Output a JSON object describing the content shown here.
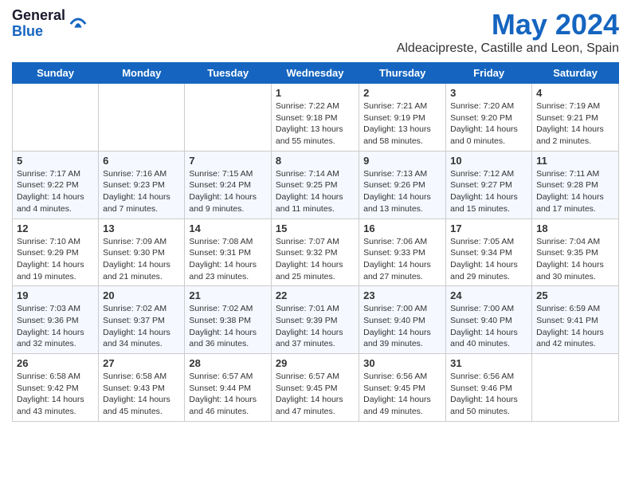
{
  "header": {
    "logo_general": "General",
    "logo_blue": "Blue",
    "month_title": "May 2024",
    "location": "Aldeacipreste, Castille and Leon, Spain"
  },
  "days_of_week": [
    "Sunday",
    "Monday",
    "Tuesday",
    "Wednesday",
    "Thursday",
    "Friday",
    "Saturday"
  ],
  "weeks": [
    [
      {
        "day": "",
        "sunrise": "",
        "sunset": "",
        "daylight": ""
      },
      {
        "day": "",
        "sunrise": "",
        "sunset": "",
        "daylight": ""
      },
      {
        "day": "",
        "sunrise": "",
        "sunset": "",
        "daylight": ""
      },
      {
        "day": "1",
        "sunrise": "Sunrise: 7:22 AM",
        "sunset": "Sunset: 9:18 PM",
        "daylight": "Daylight: 13 hours and 55 minutes."
      },
      {
        "day": "2",
        "sunrise": "Sunrise: 7:21 AM",
        "sunset": "Sunset: 9:19 PM",
        "daylight": "Daylight: 13 hours and 58 minutes."
      },
      {
        "day": "3",
        "sunrise": "Sunrise: 7:20 AM",
        "sunset": "Sunset: 9:20 PM",
        "daylight": "Daylight: 14 hours and 0 minutes."
      },
      {
        "day": "4",
        "sunrise": "Sunrise: 7:19 AM",
        "sunset": "Sunset: 9:21 PM",
        "daylight": "Daylight: 14 hours and 2 minutes."
      }
    ],
    [
      {
        "day": "5",
        "sunrise": "Sunrise: 7:17 AM",
        "sunset": "Sunset: 9:22 PM",
        "daylight": "Daylight: 14 hours and 4 minutes."
      },
      {
        "day": "6",
        "sunrise": "Sunrise: 7:16 AM",
        "sunset": "Sunset: 9:23 PM",
        "daylight": "Daylight: 14 hours and 7 minutes."
      },
      {
        "day": "7",
        "sunrise": "Sunrise: 7:15 AM",
        "sunset": "Sunset: 9:24 PM",
        "daylight": "Daylight: 14 hours and 9 minutes."
      },
      {
        "day": "8",
        "sunrise": "Sunrise: 7:14 AM",
        "sunset": "Sunset: 9:25 PM",
        "daylight": "Daylight: 14 hours and 11 minutes."
      },
      {
        "day": "9",
        "sunrise": "Sunrise: 7:13 AM",
        "sunset": "Sunset: 9:26 PM",
        "daylight": "Daylight: 14 hours and 13 minutes."
      },
      {
        "day": "10",
        "sunrise": "Sunrise: 7:12 AM",
        "sunset": "Sunset: 9:27 PM",
        "daylight": "Daylight: 14 hours and 15 minutes."
      },
      {
        "day": "11",
        "sunrise": "Sunrise: 7:11 AM",
        "sunset": "Sunset: 9:28 PM",
        "daylight": "Daylight: 14 hours and 17 minutes."
      }
    ],
    [
      {
        "day": "12",
        "sunrise": "Sunrise: 7:10 AM",
        "sunset": "Sunset: 9:29 PM",
        "daylight": "Daylight: 14 hours and 19 minutes."
      },
      {
        "day": "13",
        "sunrise": "Sunrise: 7:09 AM",
        "sunset": "Sunset: 9:30 PM",
        "daylight": "Daylight: 14 hours and 21 minutes."
      },
      {
        "day": "14",
        "sunrise": "Sunrise: 7:08 AM",
        "sunset": "Sunset: 9:31 PM",
        "daylight": "Daylight: 14 hours and 23 minutes."
      },
      {
        "day": "15",
        "sunrise": "Sunrise: 7:07 AM",
        "sunset": "Sunset: 9:32 PM",
        "daylight": "Daylight: 14 hours and 25 minutes."
      },
      {
        "day": "16",
        "sunrise": "Sunrise: 7:06 AM",
        "sunset": "Sunset: 9:33 PM",
        "daylight": "Daylight: 14 hours and 27 minutes."
      },
      {
        "day": "17",
        "sunrise": "Sunrise: 7:05 AM",
        "sunset": "Sunset: 9:34 PM",
        "daylight": "Daylight: 14 hours and 29 minutes."
      },
      {
        "day": "18",
        "sunrise": "Sunrise: 7:04 AM",
        "sunset": "Sunset: 9:35 PM",
        "daylight": "Daylight: 14 hours and 30 minutes."
      }
    ],
    [
      {
        "day": "19",
        "sunrise": "Sunrise: 7:03 AM",
        "sunset": "Sunset: 9:36 PM",
        "daylight": "Daylight: 14 hours and 32 minutes."
      },
      {
        "day": "20",
        "sunrise": "Sunrise: 7:02 AM",
        "sunset": "Sunset: 9:37 PM",
        "daylight": "Daylight: 14 hours and 34 minutes."
      },
      {
        "day": "21",
        "sunrise": "Sunrise: 7:02 AM",
        "sunset": "Sunset: 9:38 PM",
        "daylight": "Daylight: 14 hours and 36 minutes."
      },
      {
        "day": "22",
        "sunrise": "Sunrise: 7:01 AM",
        "sunset": "Sunset: 9:39 PM",
        "daylight": "Daylight: 14 hours and 37 minutes."
      },
      {
        "day": "23",
        "sunrise": "Sunrise: 7:00 AM",
        "sunset": "Sunset: 9:40 PM",
        "daylight": "Daylight: 14 hours and 39 minutes."
      },
      {
        "day": "24",
        "sunrise": "Sunrise: 7:00 AM",
        "sunset": "Sunset: 9:40 PM",
        "daylight": "Daylight: 14 hours and 40 minutes."
      },
      {
        "day": "25",
        "sunrise": "Sunrise: 6:59 AM",
        "sunset": "Sunset: 9:41 PM",
        "daylight": "Daylight: 14 hours and 42 minutes."
      }
    ],
    [
      {
        "day": "26",
        "sunrise": "Sunrise: 6:58 AM",
        "sunset": "Sunset: 9:42 PM",
        "daylight": "Daylight: 14 hours and 43 minutes."
      },
      {
        "day": "27",
        "sunrise": "Sunrise: 6:58 AM",
        "sunset": "Sunset: 9:43 PM",
        "daylight": "Daylight: 14 hours and 45 minutes."
      },
      {
        "day": "28",
        "sunrise": "Sunrise: 6:57 AM",
        "sunset": "Sunset: 9:44 PM",
        "daylight": "Daylight: 14 hours and 46 minutes."
      },
      {
        "day": "29",
        "sunrise": "Sunrise: 6:57 AM",
        "sunset": "Sunset: 9:45 PM",
        "daylight": "Daylight: 14 hours and 47 minutes."
      },
      {
        "day": "30",
        "sunrise": "Sunrise: 6:56 AM",
        "sunset": "Sunset: 9:45 PM",
        "daylight": "Daylight: 14 hours and 49 minutes."
      },
      {
        "day": "31",
        "sunrise": "Sunrise: 6:56 AM",
        "sunset": "Sunset: 9:46 PM",
        "daylight": "Daylight: 14 hours and 50 minutes."
      },
      {
        "day": "",
        "sunrise": "",
        "sunset": "",
        "daylight": ""
      }
    ]
  ]
}
